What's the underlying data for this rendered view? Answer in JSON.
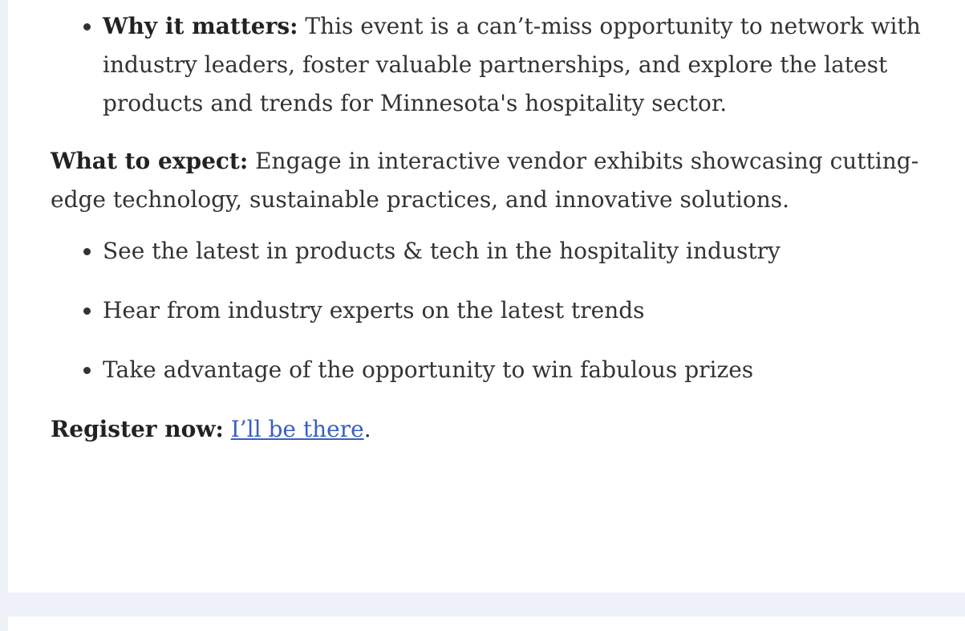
{
  "why": {
    "label": "Why it matters:",
    "text": " This event is a can’t-miss opportunity to network with industry leaders, foster valuable partnerships, and explore the latest products and trends for Minnesota's hospitality sector."
  },
  "expect": {
    "label": "What to expect:",
    "text": " Engage in interactive vendor exhibits showcasing cutting-edge technology, sustainable practices, and innovative solutions.",
    "items": [
      "See the latest in products & tech in the hospitality industry",
      "Hear from industry experts on the latest trends",
      "Take advantage of the opportunity to win fabulous prizes"
    ]
  },
  "register": {
    "label": "Register now:",
    "link_text": "I’ll be there",
    "suffix": "."
  },
  "colors": {
    "link": "#3b5fc0",
    "text": "#333333",
    "background": "#eef1f7"
  }
}
